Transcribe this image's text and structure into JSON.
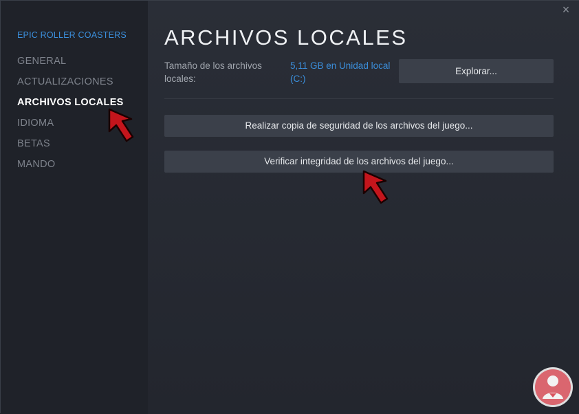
{
  "sidebar": {
    "game_title": "EPIC ROLLER COASTERS",
    "items": [
      {
        "label": "GENERAL"
      },
      {
        "label": "ACTUALIZACIONES"
      },
      {
        "label": "ARCHIVOS LOCALES",
        "active": true
      },
      {
        "label": "IDIOMA"
      },
      {
        "label": "BETAS"
      },
      {
        "label": "MANDO"
      }
    ]
  },
  "main": {
    "title": "ARCHIVOS LOCALES",
    "size_label": "Tamaño de los archivos locales:",
    "size_value": "5,11 GB en Unidad local (C:)",
    "explore_label": "Explorar...",
    "backup_label": "Realizar copia de seguridad de los archivos del juego...",
    "verify_label": "Verificar integridad de los archivos del juego..."
  },
  "window": {
    "close_glyph": "×"
  },
  "icons": [
    "close-icon",
    "red-arrow-pointer-icon",
    "watermark-logo-icon"
  ],
  "colors": {
    "accent": "#3b8fdc",
    "arrow": "#c4151c",
    "sidebar_bg": "#1f2229"
  }
}
